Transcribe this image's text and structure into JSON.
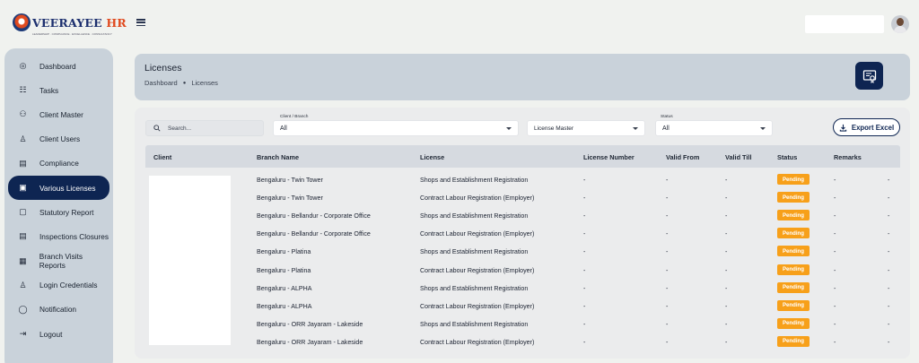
{
  "brand": {
    "name_main": "VEERAYEE",
    "name_accent": "HR",
    "tagline": "LEADERSHIP · COMPLIANCE · EXCELLENCE · CONSULTANCY"
  },
  "sidebar": {
    "items": [
      {
        "label": "Dashboard",
        "icon": "dashboard-icon",
        "glyph": "◎"
      },
      {
        "label": "Tasks",
        "icon": "tasks-icon",
        "glyph": "☷"
      },
      {
        "label": "Client Master",
        "icon": "users-icon",
        "glyph": "⚇"
      },
      {
        "label": "Client Users",
        "icon": "user-icon",
        "glyph": "♙"
      },
      {
        "label": "Compliance",
        "icon": "compliance-icon",
        "glyph": "▤"
      },
      {
        "label": "Various Licenses",
        "icon": "license-icon",
        "glyph": "▣"
      },
      {
        "label": "Statutory Report",
        "icon": "report-icon",
        "glyph": "▢"
      },
      {
        "label": "Inspections Closures",
        "icon": "inspection-icon",
        "glyph": "▤"
      },
      {
        "label": "Branch Visits Reports",
        "icon": "calendar-icon",
        "glyph": "▦"
      },
      {
        "label": "Login Credentials",
        "icon": "key-user-icon",
        "glyph": "♙"
      },
      {
        "label": "Notification",
        "icon": "chat-icon",
        "glyph": "◯"
      },
      {
        "label": "Logout",
        "icon": "logout-icon",
        "glyph": "⇥"
      }
    ]
  },
  "header": {
    "title": "Licenses",
    "breadcrumb": [
      "Dashboard",
      "Licenses"
    ]
  },
  "filters": {
    "search_placeholder": "Search...",
    "client_branch": {
      "label": "Client / Branch",
      "value": "All"
    },
    "license_master": {
      "value": "License Master"
    },
    "status": {
      "label": "Status",
      "value": "All"
    },
    "export_label": "Export Excel"
  },
  "table": {
    "columns": [
      "Client",
      "Branch Name",
      "License",
      "License Number",
      "Valid From",
      "Valid Till",
      "Status",
      "Remarks"
    ],
    "rows": [
      {
        "branch": "Bengaluru - Twin Tower",
        "license": "Shops and Establishment Registration",
        "number": "-",
        "from": "-",
        "till": "-",
        "status": "Pending",
        "remarks": "-",
        "extra": "-"
      },
      {
        "branch": "Bengaluru - Twin Tower",
        "license": "Contract Labour Registration (Employer)",
        "number": "-",
        "from": "-",
        "till": "-",
        "status": "Pending",
        "remarks": "-",
        "extra": "-"
      },
      {
        "branch": "Bengaluru - Bellandur - Corporate Office",
        "license": "Shops and Establishment Registration",
        "number": "-",
        "from": "-",
        "till": "-",
        "status": "Pending",
        "remarks": "-",
        "extra": "-"
      },
      {
        "branch": "Bengaluru - Bellandur - Corporate Office",
        "license": "Contract Labour Registration (Employer)",
        "number": "-",
        "from": "-",
        "till": "-",
        "status": "Pending",
        "remarks": "-",
        "extra": "-"
      },
      {
        "branch": "Bengaluru - Platina",
        "license": "Shops and Establishment Registration",
        "number": "-",
        "from": "-",
        "till": "-",
        "status": "Pending",
        "remarks": "-",
        "extra": "-"
      },
      {
        "branch": "Bengaluru - Platina",
        "license": "Contract Labour Registration (Employer)",
        "number": "-",
        "from": "-",
        "till": "-",
        "status": "Pending",
        "remarks": "-",
        "extra": "-"
      },
      {
        "branch": "Bengaluru - ALPHA",
        "license": "Shops and Establishment Registration",
        "number": "-",
        "from": "-",
        "till": "-",
        "status": "Pending",
        "remarks": "-",
        "extra": "-"
      },
      {
        "branch": "Bengaluru - ALPHA",
        "license": "Contract Labour Registration (Employer)",
        "number": "-",
        "from": "-",
        "till": "-",
        "status": "Pending",
        "remarks": "-",
        "extra": "-"
      },
      {
        "branch": "Bengaluru - ORR Jayaram - Lakeside",
        "license": "Shops and Establishment Registration",
        "number": "-",
        "from": "-",
        "till": "-",
        "status": "Pending",
        "remarks": "-",
        "extra": "-"
      },
      {
        "branch": "Bengaluru - ORR Jayaram - Lakeside",
        "license": "Contract Labour Registration (Employer)",
        "number": "-",
        "from": "-",
        "till": "-",
        "status": "Pending",
        "remarks": "-",
        "extra": "-"
      }
    ]
  },
  "colors": {
    "primary": "#0e2552",
    "panel": "#c9d2da",
    "badge": "#f7a01a",
    "accent": "#e04a1f"
  }
}
